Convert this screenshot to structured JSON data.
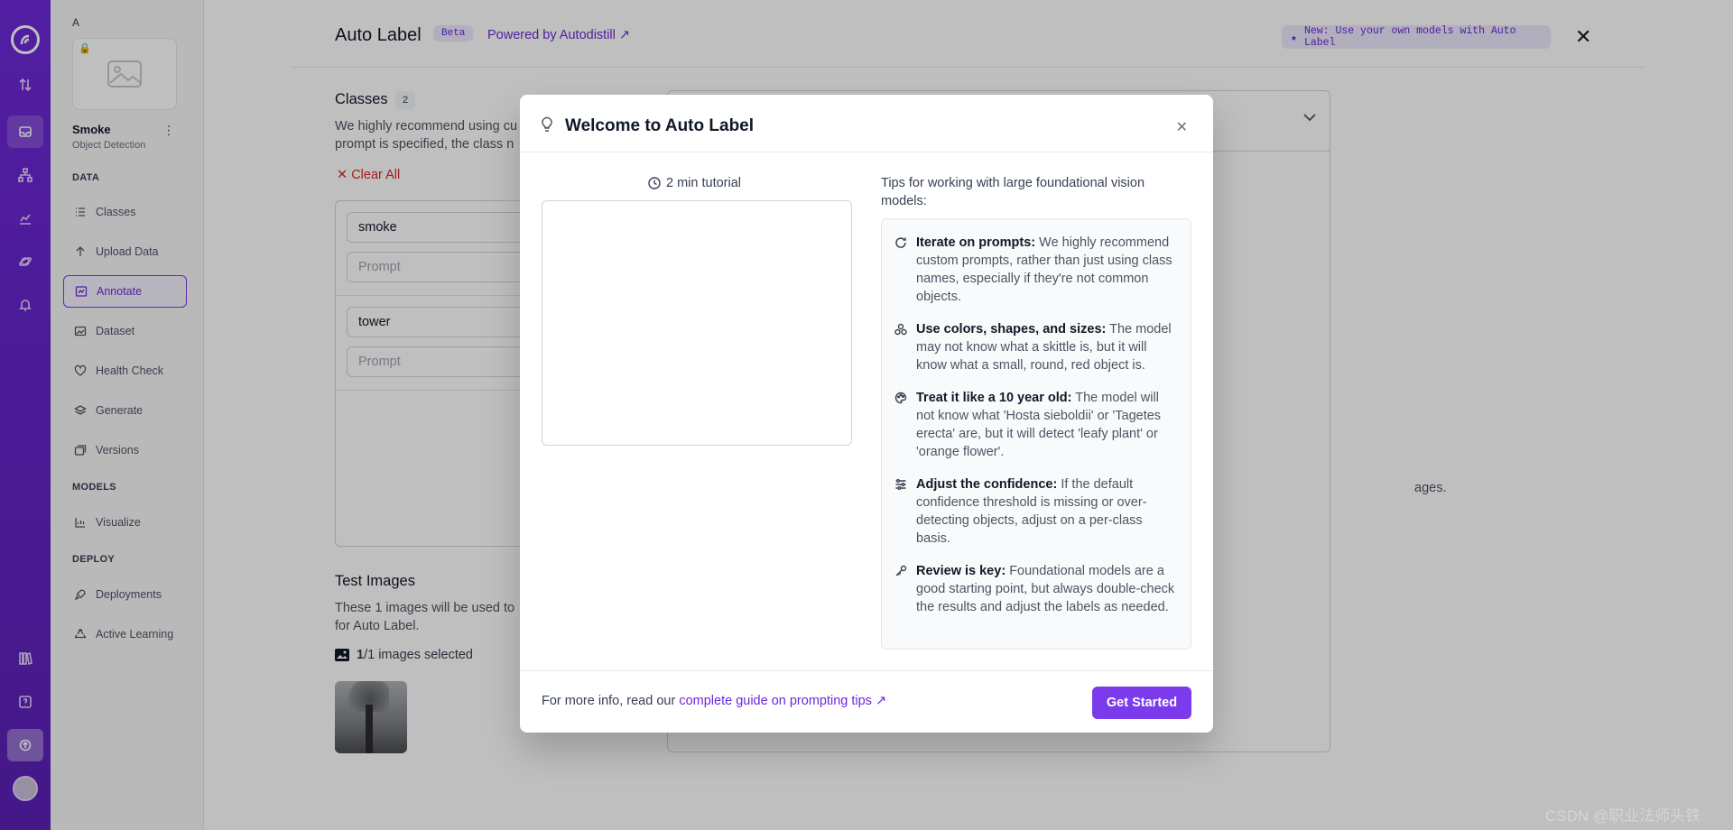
{
  "sidebar": {
    "workspace_letter": "A",
    "project_name": "Smoke",
    "project_type": "Object Detection",
    "sections": {
      "data": "DATA",
      "models": "MODELS",
      "deploy": "DEPLOY"
    },
    "items": {
      "classes": "Classes",
      "upload": "Upload Data",
      "annotate": "Annotate",
      "dataset": "Dataset",
      "health": "Health Check",
      "generate": "Generate",
      "versions": "Versions",
      "visualize": "Visualize",
      "deployments": "Deployments",
      "active_learning": "Active Learning"
    }
  },
  "header": {
    "title": "Auto Label",
    "beta_badge": "Beta",
    "powered_by": "Powered by Autodistill ↗",
    "new_banner": "New: Use your own models with Auto Label"
  },
  "classes": {
    "title": "Classes",
    "count": "2",
    "description": "We highly recommend using cu",
    "description2": "prompt is specified, the class n",
    "clear_all": "Clear All",
    "items": [
      {
        "name": "smoke",
        "prompt_placeholder": "Prompt"
      },
      {
        "name": "tower",
        "prompt_placeholder": "Prompt"
      }
    ]
  },
  "test_images": {
    "title": "Test Images",
    "description": "These 1 images will be used to",
    "description2": "for Auto Label.",
    "selected_count": "1",
    "selected_suffix": "/1 images selected"
  },
  "right_panel": {
    "partial_text": "ages."
  },
  "modal": {
    "title": "Welcome to Auto Label",
    "tutorial_label": "2 min tutorial",
    "tips_heading": "Tips for working with large foundational vision models:",
    "tips": [
      {
        "icon": "refresh-icon",
        "title": "Iterate on prompts:",
        "text": "We highly recommend custom prompts, rather than just using class names, especially if they're not common objects."
      },
      {
        "icon": "shapes-icon",
        "title": "Use colors, shapes, and sizes:",
        "text": "The model may not know what a skittle is, but it will know what a small, round, red object is."
      },
      {
        "icon": "palette-icon",
        "title": "Treat it like a 10 year old:",
        "text": "The model will not know what 'Hosta sieboldii' or 'Tagetes erecta' are, but it will detect 'leafy plant' or 'orange flower'."
      },
      {
        "icon": "sliders-icon",
        "title": "Adjust the confidence:",
        "text": "If the default confidence threshold is missing or over-detecting objects, adjust on a per-class basis."
      },
      {
        "icon": "key-icon",
        "title": "Review is key:",
        "text": "Foundational models are a good starting point, but always double-check the results and adjust the labels as needed."
      }
    ],
    "footer_text": "For more info, read our",
    "footer_link": "complete guide on prompting tips ↗",
    "get_started": "Get Started"
  },
  "watermark": "CSDN @职业法师头铁",
  "colors": {
    "brand": "#7c3aed",
    "rail": "#6d28d9",
    "danger": "#dc2626"
  }
}
